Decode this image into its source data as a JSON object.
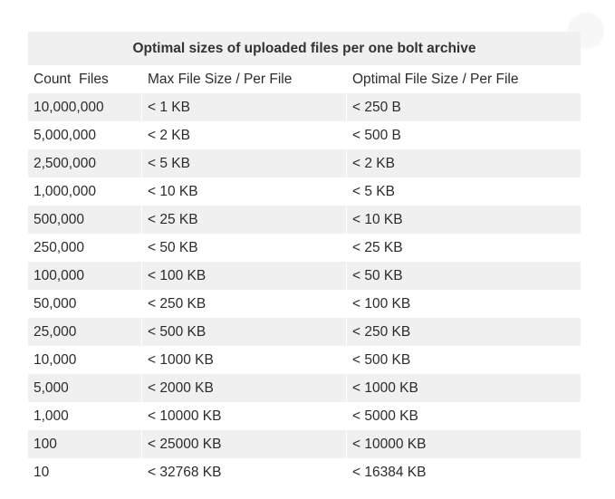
{
  "table": {
    "caption": "Optimal sizes of uploaded files per one bolt archive",
    "headers": [
      "Count  Files",
      "Max File Size / Per File",
      "Optimal File Size / Per File"
    ],
    "rows": [
      [
        "10,000,000",
        "< 1 KB",
        "< 250 B"
      ],
      [
        "5,000,000",
        "< 2 KB",
        "< 500 B"
      ],
      [
        "2,500,000",
        "< 5 KB",
        "< 2 KB"
      ],
      [
        "1,000,000",
        "< 10 KB",
        "< 5 KB"
      ],
      [
        "500,000",
        "< 25 KB",
        "< 10 KB"
      ],
      [
        "250,000",
        "< 50 KB",
        "< 25 KB"
      ],
      [
        "100,000",
        "< 100 KB",
        "< 50 KB"
      ],
      [
        "50,000",
        "< 250 KB",
        "< 100 KB"
      ],
      [
        "25,000",
        "< 500 KB",
        "< 250 KB"
      ],
      [
        "10,000",
        "< 1000 KB",
        "< 500 KB"
      ],
      [
        "5,000",
        "< 2000 KB",
        "< 1000 KB"
      ],
      [
        "1,000",
        "< 10000 KB",
        "< 5000 KB"
      ],
      [
        "100",
        "< 25000 KB",
        "< 10000 KB"
      ],
      [
        "10",
        "< 32768 KB",
        "< 16384 KB"
      ]
    ]
  }
}
